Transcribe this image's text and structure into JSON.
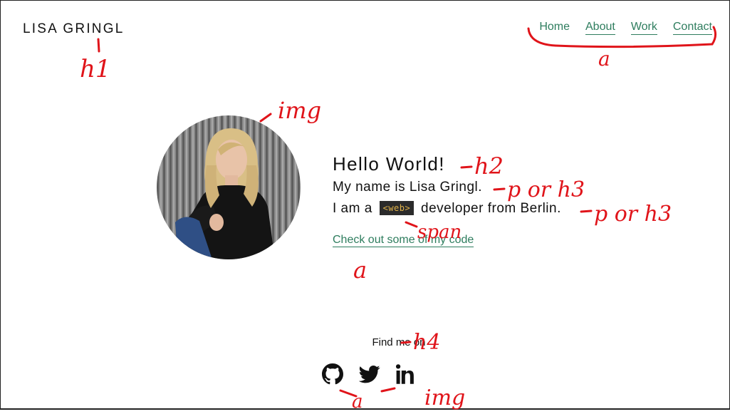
{
  "header": {
    "logo": "LISA GRINGL",
    "nav": [
      "Home",
      "About",
      "Work",
      "Contact"
    ]
  },
  "hero": {
    "heading": "Hello World!",
    "name_line": "My name is Lisa Gringl.",
    "role_prefix": "I am a",
    "role_tag": "<web>",
    "role_suffix": "developer from Berlin.",
    "code_link": "Check out some of my code"
  },
  "social": {
    "heading": "Find me on",
    "icons": [
      "github-icon",
      "twitter-icon",
      "linkedin-icon"
    ]
  },
  "annotations": {
    "logo": "h1",
    "nav": "a",
    "img": "img",
    "heading": "h2",
    "name": "p or h3",
    "role": "p or h3",
    "tag": "span",
    "link": "a",
    "find": "h4",
    "social_a": "a",
    "social_img": "img"
  },
  "colors": {
    "accent": "#2e7d5e",
    "tag_bg": "#2b2b2b",
    "tag_text": "#e0b24a",
    "annotation": "#e0141a"
  }
}
